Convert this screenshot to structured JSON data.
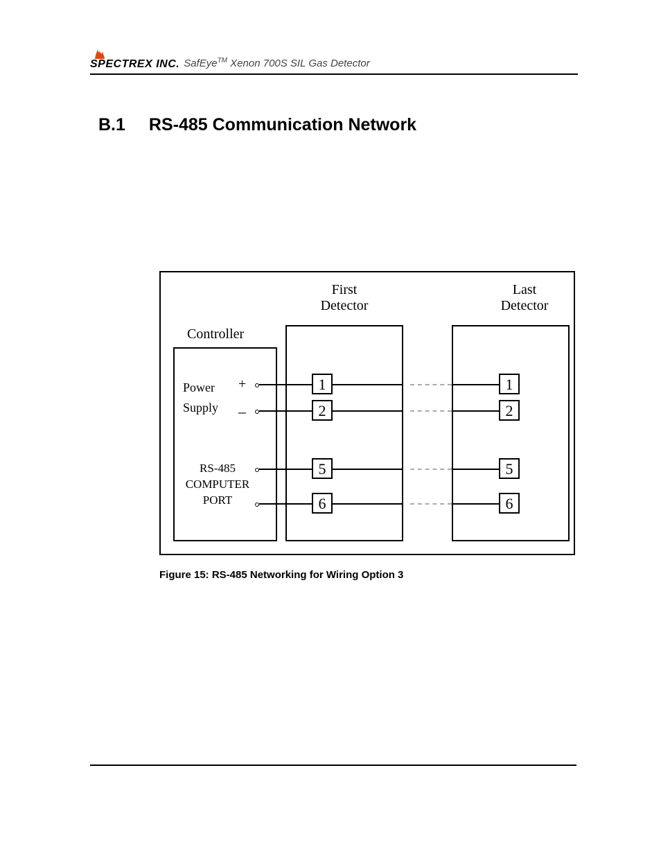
{
  "header": {
    "brand": "SPECTREX INC.",
    "product": "SafEye",
    "tm": "TM",
    "suffix": " Xenon 700S SIL Gas Detector"
  },
  "heading": {
    "number": "B.1",
    "title": "RS-485 Communication Network"
  },
  "diagram": {
    "col_first": "First\nDetector",
    "col_last": "Last\nDetector",
    "controller": "Controller",
    "power_supply_line1": "Power",
    "power_supply_line2": "Supply",
    "plus": "+",
    "minus": "–",
    "rs485_line1": "RS-485",
    "rs485_line2": "COMPUTER",
    "rs485_line3": "PORT",
    "pins": {
      "p1": "1",
      "p2": "2",
      "p5": "5",
      "p6": "6"
    }
  },
  "caption": "Figure 15: RS-485 Networking for Wiring Option 3"
}
